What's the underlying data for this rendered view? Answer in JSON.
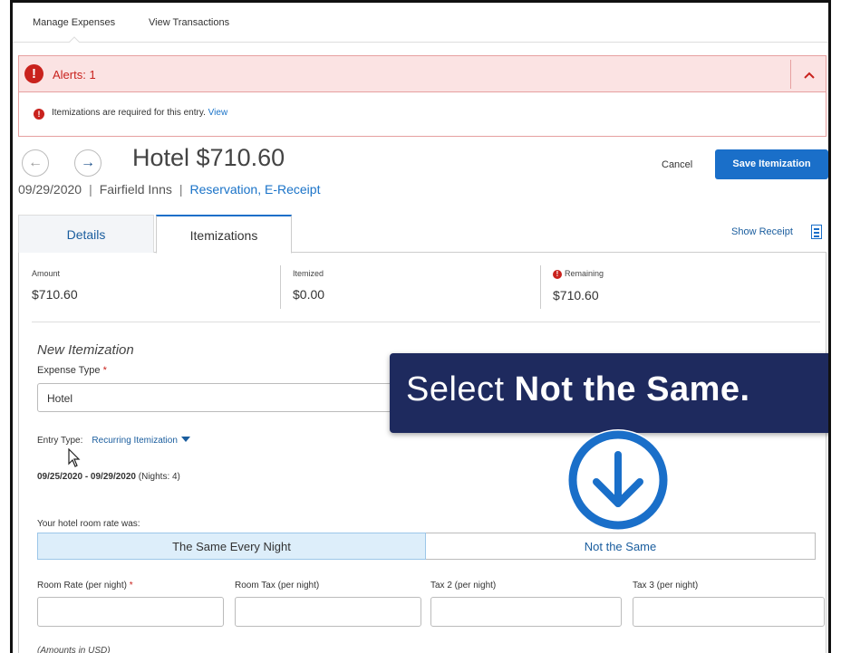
{
  "topnav": {
    "items": [
      "Manage Expenses",
      "View Transactions"
    ]
  },
  "alert": {
    "title": "Alerts: 1",
    "message": "Itemizations are required for this entry.",
    "link": "View"
  },
  "header": {
    "title": "Hotel $710.60",
    "date": "09/29/2020",
    "vendor": "Fairfield Inns",
    "receipt_info": "Reservation, E-Receipt",
    "cancel_label": "Cancel",
    "save_label": "Save Itemization"
  },
  "tabs": {
    "items": [
      {
        "label": "Details"
      },
      {
        "label": "Itemizations"
      }
    ],
    "show_receipt": "Show Receipt"
  },
  "summary": {
    "amount_label": "Amount",
    "amount_value": "$710.60",
    "itemized_label": "Itemized",
    "itemized_value": "$0.00",
    "remaining_label": "Remaining",
    "remaining_value": "$710.60"
  },
  "form": {
    "section_title": "New Itemization",
    "expense_type_label": "Expense Type",
    "required_mark": "*",
    "expense_type_value": "Hotel",
    "entry_type_label": "Entry Type:",
    "entry_type_value": "Recurring Itemization",
    "date_range": "09/25/2020 - 09/29/2020",
    "nights": "(Nights: 4)",
    "rate_question": "Your hotel room rate was:",
    "option_same": "The Same Every Night",
    "option_not_same": "Not the Same",
    "room_rate_label": "Room Rate (per night)",
    "room_tax_label": "Room Tax (per night)",
    "tax2_label": "Tax 2 (per night)",
    "tax3_label": "Tax 3 (per night)",
    "amounts_note": "(Amounts in USD)"
  },
  "overlay": {
    "text_prefix": "Select ",
    "text_emphasis": "Not the Same."
  },
  "colors": {
    "accent": "#1a6fc9",
    "alert": "#c9221d",
    "callout_bg": "#1e2a5e"
  }
}
